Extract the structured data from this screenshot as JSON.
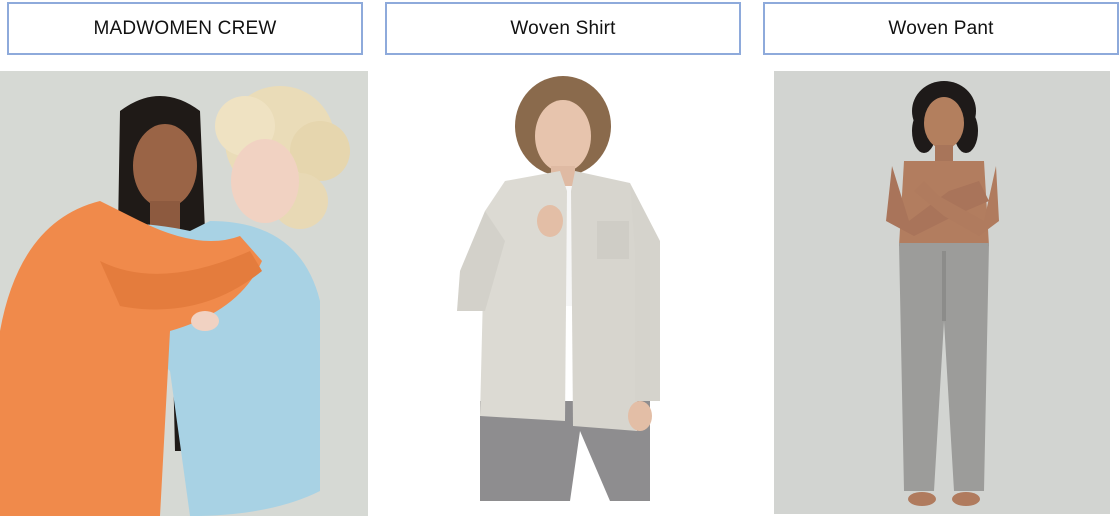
{
  "products": [
    {
      "label": "MADWOMEN CREW",
      "image": "two-models-sweatshirts-photo"
    },
    {
      "label": "Woven Shirt",
      "image": "model-woven-shirt-photo"
    },
    {
      "label": "Woven Pant",
      "image": "model-woven-pant-photo"
    }
  ],
  "colors": {
    "label_border": "#8eaadb",
    "orange_sweatshirt": "#f08a4b",
    "blue_sweatshirt": "#a9d3e6",
    "shirt": "#dcdad4",
    "pant": "#9c9c9a"
  }
}
